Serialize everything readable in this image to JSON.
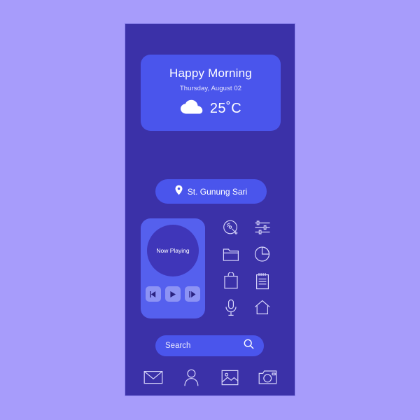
{
  "theme": {
    "background": "#a79cfb",
    "phone_screen": "#3b31a8",
    "phone_border": "#8f86ef",
    "card": "#4a55ec",
    "music_card": "#5560ee",
    "disc": "#3f36b9",
    "button": "#8d93f4",
    "text": "#ffffff",
    "muted_text": "#e7e6fb"
  },
  "weather": {
    "greeting": "Happy Morning",
    "date": "Thursday, August 02",
    "temperature": "25˚C",
    "condition_icon": "cloud-icon"
  },
  "location": {
    "label": "St. Gunung Sari",
    "icon": "map-pin-icon"
  },
  "music": {
    "now_playing_label": "Now Playing",
    "controls": [
      {
        "name": "previous-button",
        "icon": "previous-icon"
      },
      {
        "name": "play-button",
        "icon": "play-icon"
      },
      {
        "name": "next-button",
        "icon": "next-icon"
      }
    ]
  },
  "icon_grid": [
    {
      "name": "vinyl-record-icon",
      "label": "Music"
    },
    {
      "name": "sliders-icon",
      "label": "Equalizer"
    },
    {
      "name": "folder-icon",
      "label": "Files"
    },
    {
      "name": "pie-chart-icon",
      "label": "Statistics"
    },
    {
      "name": "shopping-bag-icon",
      "label": "Shop"
    },
    {
      "name": "notepad-icon",
      "label": "Notes"
    },
    {
      "name": "microphone-icon",
      "label": "Voice"
    },
    {
      "name": "home-icon",
      "label": "Home"
    }
  ],
  "search": {
    "placeholder": "Search",
    "icon": "search-icon"
  },
  "bottom_nav": [
    {
      "name": "mail-icon",
      "label": "Mail"
    },
    {
      "name": "user-icon",
      "label": "Profile"
    },
    {
      "name": "gallery-icon",
      "label": "Gallery"
    },
    {
      "name": "camera-icon",
      "label": "Camera"
    }
  ]
}
